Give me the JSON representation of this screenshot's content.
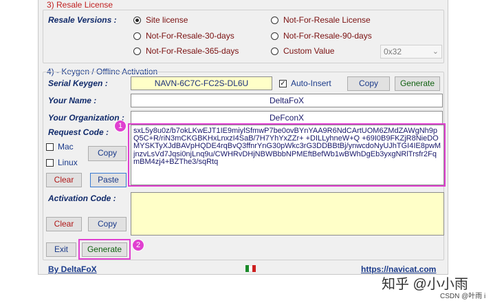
{
  "resale": {
    "title": "3) Resale License",
    "versions_label": "Resale Versions :",
    "options": [
      {
        "label": "Site license",
        "selected": true
      },
      {
        "label": "Not-For-Resale License",
        "selected": false
      },
      {
        "label": "Not-For-Resale-30-days",
        "selected": false
      },
      {
        "label": "Not-For-Resale-90-days",
        "selected": false
      },
      {
        "label": "Not-For-Resale-365-days",
        "selected": false
      },
      {
        "label": "Custom Value",
        "selected": false
      }
    ],
    "custom_value": "0x32"
  },
  "keygen": {
    "title": "4) - Keygen / Offline Activation",
    "serial_label": "Serial Keygen :",
    "serial_value": "NAVN-6C7C-FC2S-DL6U",
    "auto_insert_label": "Auto-Insert",
    "auto_insert_checked": true,
    "copy_label": "Copy",
    "generate_label": "Generate",
    "name_label": "Your Name :",
    "name_value": "DeltaFoX",
    "org_label": "Your Organization :",
    "org_value": "DeFconX",
    "request_label": "Request Code :",
    "request_value": "sxL5y8u0z/b7okLKwEJT1IE9miylSfmwP7be0ovBYnYAA9R6NdCArtUOM6ZMdZAWgNh9pQ5C+R/riN3mCKGBKHxLnxzI4SaB/7H7YhYxZZr+\n+DILLyhneW+Q\n+69I0B9FKZjR8NieDOMYSKTyXJdBAVpHQDE4rqBvQ3ffnrYnG30pWkc3rG3DDBBtBj/ynwcdoNyUJhTGI4IE8pwMjnzvLsVd7Jqsi0njLnq9u/CWHRvDHjNBWBbbNPMEftBefWb1wBWhDgEb3yxgNRlTrsfr2FqmBM4zj4+BZThe3/sqRtq",
    "mac_label": "Mac",
    "linux_label": "Linux",
    "request_copy_label": "Copy",
    "clear_label": "Clear",
    "paste_label": "Paste",
    "activation_label": "Activation Code :",
    "activation_value": "",
    "activation_clear_label": "Clear",
    "activation_copy_label": "Copy",
    "exit_label": "Exit",
    "activation_generate_label": "Generate"
  },
  "annotations": {
    "badge1": "1",
    "badge2": "2"
  },
  "footer": {
    "by_label": "By DeltaFoX",
    "url": "https://navicat.com"
  },
  "watermark": {
    "primary": "知乎 @小小雨",
    "secondary": "CSDN @叶雨 i"
  },
  "colors": {
    "highlight": "#e040d0",
    "field_yellow": "#ffffc8",
    "label_blue": "#102a6a"
  }
}
